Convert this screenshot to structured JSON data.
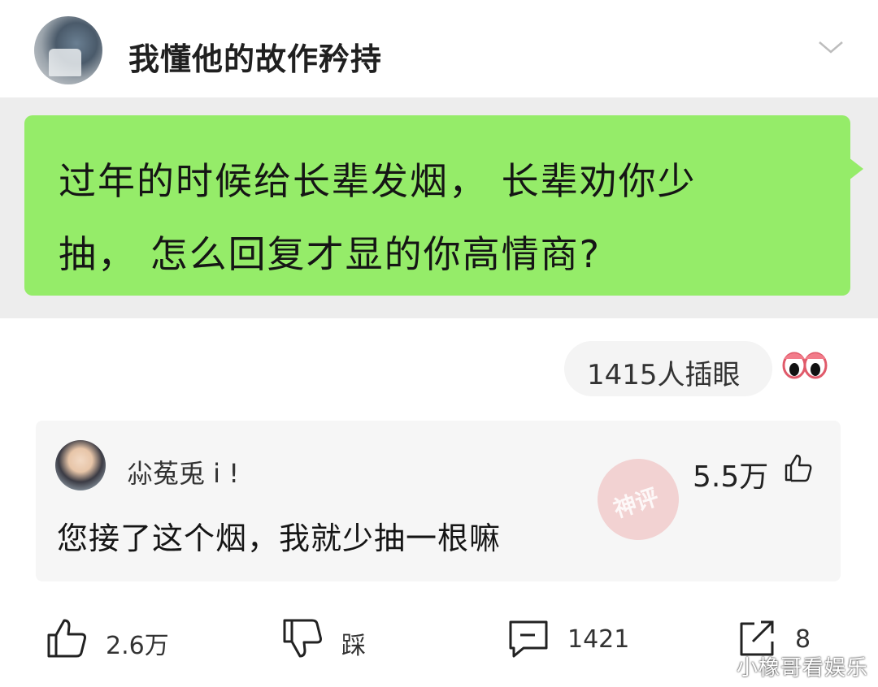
{
  "header": {
    "title": "我懂他的故作矜持"
  },
  "post": {
    "line1": "过年的时候给长辈发烟， 长辈劝你少",
    "line2": "抽， 怎么回复才显的你高情商?"
  },
  "poke": {
    "label": "1415人插眼"
  },
  "comment": {
    "username": "尛菟兎 i !",
    "likes": "5.5万",
    "text": "您接了这个烟，我就少抽一根嘛",
    "badge": "神评"
  },
  "actions": {
    "like": "2.6万",
    "dislike": "踩",
    "comments": "1421",
    "share": "8"
  },
  "watermark": "小橡哥看娱乐"
}
